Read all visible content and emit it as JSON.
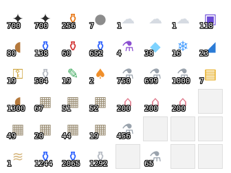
{
  "inventory": {
    "slots": [
      {
        "icon": "throwing-star-icon",
        "qty": "700"
      },
      {
        "icon": "throwing-star-icon",
        "qty": "700"
      },
      {
        "icon": "orange-potion-icon",
        "qty": "256"
      },
      {
        "icon": "silver-coin-icon",
        "qty": "7"
      },
      {
        "icon": "cloud-icon",
        "qty": "1"
      },
      {
        "icon": "cloud-icon",
        "qty": ""
      },
      {
        "icon": "cloud-icon",
        "qty": "1"
      },
      {
        "icon": "scroll-box-icon",
        "qty": "118"
      },
      {
        "icon": "bread-icon",
        "qty": "80"
      },
      {
        "icon": "blue-potion-icon",
        "qty": "138"
      },
      {
        "icon": "red-potion-icon",
        "qty": "60"
      },
      {
        "icon": "blue-potion-icon",
        "qty": "652"
      },
      {
        "icon": "potion-bundle-icon",
        "qty": "4"
      },
      {
        "icon": "crystal-icon",
        "qty": "38"
      },
      {
        "icon": "ice-scroll-icon",
        "qty": "16"
      },
      {
        "icon": "blue-pouch-icon",
        "qty": "23"
      },
      {
        "icon": "gold-key-icon",
        "qty": "19"
      },
      {
        "icon": "bottle-icon",
        "qty": "504"
      },
      {
        "icon": "syringe-icon",
        "qty": "19"
      },
      {
        "icon": "mushroom-icon",
        "qty": "2"
      },
      {
        "icon": "white-potion-icon",
        "qty": "750"
      },
      {
        "icon": "white-potion-icon",
        "qty": "699"
      },
      {
        "icon": "white-potion-icon",
        "qty": "1000"
      },
      {
        "icon": "mushroom-card-icon",
        "qty": "7"
      },
      {
        "icon": "bread-icon",
        "qty": "1300"
      },
      {
        "icon": "map-icon",
        "qty": "67"
      },
      {
        "icon": "map-icon",
        "qty": "51"
      },
      {
        "icon": "map-icon",
        "qty": "52"
      },
      {
        "icon": "house-icon",
        "qty": "200"
      },
      {
        "icon": "house-icon",
        "qty": "200"
      },
      {
        "icon": "house-icon",
        "qty": "200"
      },
      {
        "icon": "",
        "qty": ""
      },
      {
        "icon": "map-icon",
        "qty": "49"
      },
      {
        "icon": "map-icon",
        "qty": "20"
      },
      {
        "icon": "map-icon",
        "qty": "44"
      },
      {
        "icon": "map-icon",
        "qty": "19"
      },
      {
        "icon": "white-potion-icon",
        "qty": "456"
      },
      {
        "icon": "",
        "qty": ""
      },
      {
        "icon": "",
        "qty": ""
      },
      {
        "icon": "",
        "qty": ""
      },
      {
        "icon": "parchment-icon",
        "qty": "1"
      },
      {
        "icon": "blue-potion-icon",
        "qty": "1244"
      },
      {
        "icon": "blue-potion-icon",
        "qty": "2065"
      },
      {
        "icon": "bottle-icon",
        "qty": "1292"
      },
      {
        "icon": "",
        "qty": ""
      },
      {
        "icon": "white-potion-icon",
        "qty": "65"
      },
      {
        "icon": "",
        "qty": ""
      },
      {
        "icon": "",
        "qty": ""
      }
    ]
  }
}
